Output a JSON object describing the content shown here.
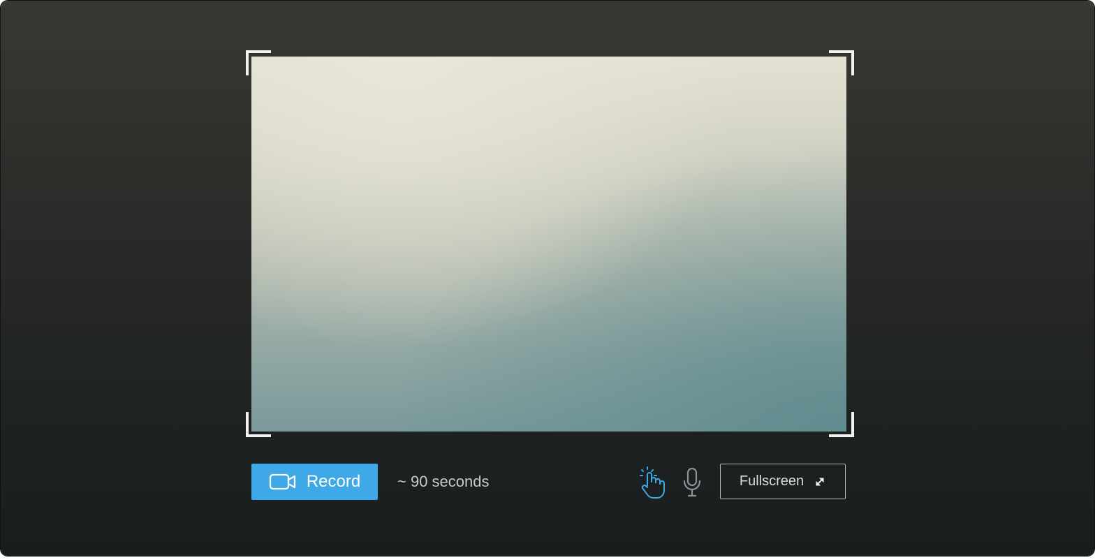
{
  "capture": {
    "record_label": "Record",
    "duration_text": "~ 90 seconds",
    "fullscreen_label": "Fullscreen"
  },
  "icons": {
    "record": "video-camera-icon",
    "touch": "touch-indicator-icon",
    "microphone": "microphone-icon",
    "fullscreen": "expand-arrows-icon"
  },
  "colors": {
    "accent": "#3ea9e6",
    "background_top": "#383833",
    "background_bottom": "#181d1e",
    "frame_corners": "#f2f2f2",
    "muted_text": "#c9cacb"
  }
}
